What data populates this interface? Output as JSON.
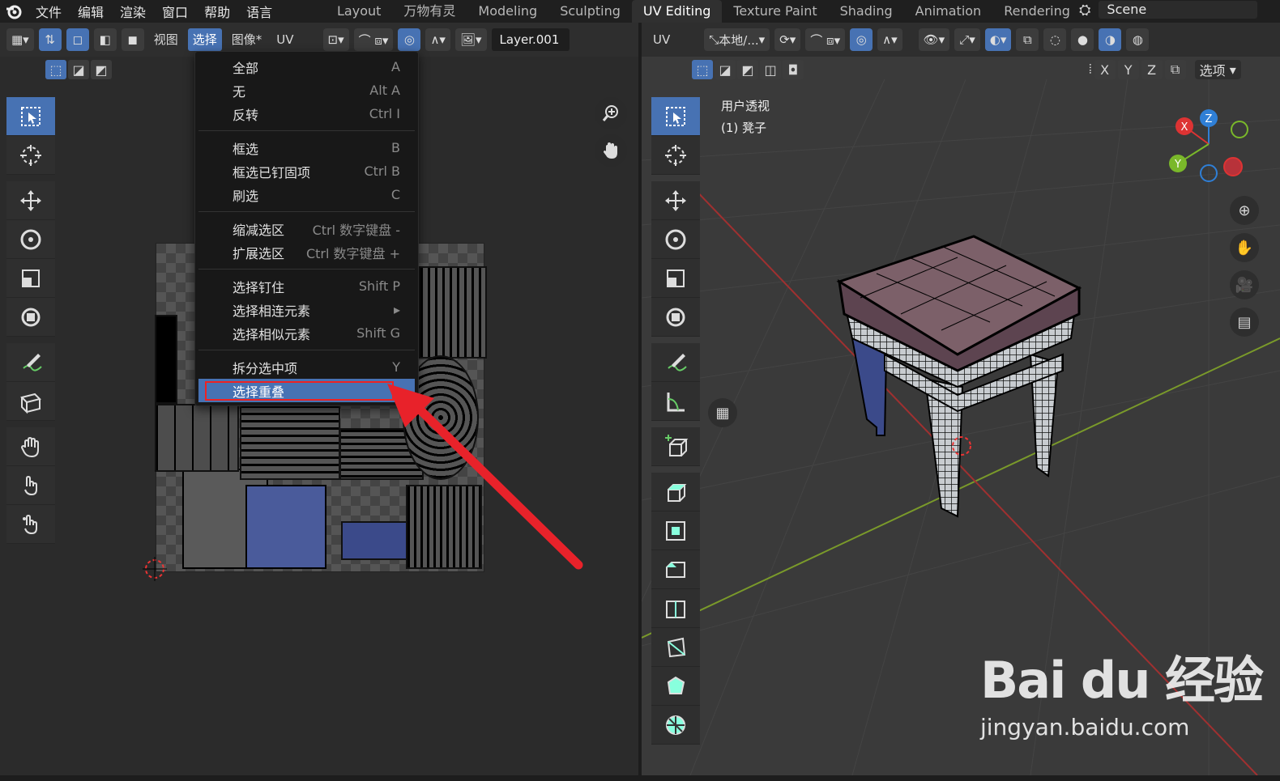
{
  "topbar": {
    "menus": [
      "文件",
      "编辑",
      "渲染",
      "窗口",
      "帮助",
      "语言"
    ],
    "workspaces": [
      "Layout",
      "万物有灵",
      "Modeling",
      "Sculpting",
      "UV Editing",
      "Texture Paint",
      "Shading",
      "Animation",
      "Rendering"
    ],
    "active_workspace": "UV Editing",
    "scene_name": "Scene"
  },
  "uv_editor": {
    "header_menus": [
      "视图",
      "选择",
      "图像*",
      "UV"
    ],
    "active_menu": "选择",
    "layer_name": "Layer.001",
    "uv_label": "UV"
  },
  "select_menu": {
    "items": [
      {
        "label": "全部",
        "shortcut": "A"
      },
      {
        "label": "无",
        "shortcut": "Alt A"
      },
      {
        "label": "反转",
        "shortcut": "Ctrl I"
      },
      {
        "label": "框选",
        "shortcut": "B"
      },
      {
        "label": "框选已钉固项",
        "shortcut": "Ctrl B"
      },
      {
        "label": "刷选",
        "shortcut": "C"
      },
      {
        "label": "缩减选区",
        "shortcut": "Ctrl 数字键盘 -"
      },
      {
        "label": "扩展选区",
        "shortcut": "Ctrl 数字键盘 +"
      },
      {
        "label": "选择钉住",
        "shortcut": "Shift P"
      },
      {
        "label": "选择相连元素",
        "shortcut": "▸"
      },
      {
        "label": "选择相似元素",
        "shortcut": "Shift G"
      },
      {
        "label": "拆分选中项",
        "shortcut": "Y"
      },
      {
        "label": "选择重叠",
        "shortcut": ""
      }
    ]
  },
  "viewport": {
    "transform_orientation": "本地/...",
    "options_label": "选项",
    "axes": [
      "X",
      "Y",
      "Z"
    ],
    "view_name": "用户透视",
    "object_name": "(1) 凳子"
  },
  "watermark": {
    "brand": "Bai du 经验",
    "url": "jingyan.baidu.com"
  },
  "colors": {
    "accent": "#4772b3",
    "annotation": "#e8222a",
    "selection": "#4772b3"
  }
}
